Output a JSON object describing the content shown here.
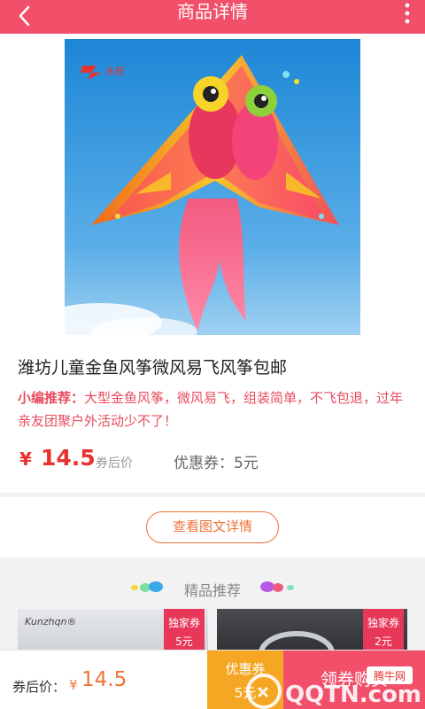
{
  "header": {
    "title": "商品详情",
    "back_icon": "chevron-left-icon",
    "more_icon": "more-vertical-icon",
    "color": "#f2506a"
  },
  "product": {
    "image_logo_text": "永旺",
    "name": "潍坊儿童金鱼风筝微风易飞风筝包邮",
    "recommend_label": "小编推荐：",
    "recommend_text": "大型金鱼风筝，微风易飞，组装简单，不飞包退，过年亲友团聚户外活动少不了！",
    "currency": "¥",
    "price": "14.5",
    "after_coupon_label": "券后价",
    "coupon_text": "优惠券：5元"
  },
  "detail_button": {
    "label": "查看图文详情"
  },
  "recommendations": {
    "title": "精品推荐",
    "items": [
      {
        "brand": "Kunzhqn®",
        "badge_line1": "独家券",
        "badge_line2": "5元"
      },
      {
        "brand": "",
        "badge_line1": "独家券",
        "badge_line2": "2元"
      }
    ]
  },
  "bottom_bar": {
    "after_price_label": "券后价：",
    "currency": "¥",
    "price": "14.5",
    "coupon_button_line1": "优惠券",
    "coupon_button_line2": "5元",
    "buy_button": "领券购买"
  },
  "watermark": {
    "brand": "QQTN.com",
    "tag": "腾牛网"
  }
}
